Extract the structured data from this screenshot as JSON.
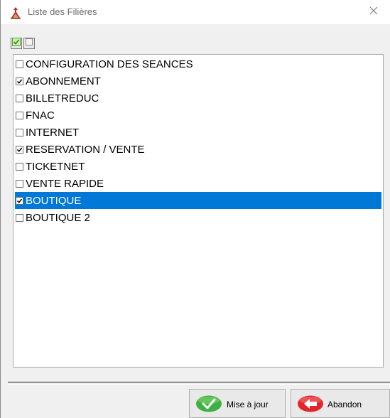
{
  "window": {
    "title": "Liste des Filières"
  },
  "toolbar": {
    "check_all_icon": "check-all-icon",
    "uncheck_all_icon": "uncheck-all-icon"
  },
  "list": {
    "items": [
      {
        "label": "CONFIGURATION DES SEANCES",
        "checked": false,
        "selected": false
      },
      {
        "label": "ABONNEMENT",
        "checked": true,
        "selected": false
      },
      {
        "label": "BILLETREDUC",
        "checked": false,
        "selected": false
      },
      {
        "label": "FNAC",
        "checked": false,
        "selected": false
      },
      {
        "label": "INTERNET",
        "checked": false,
        "selected": false
      },
      {
        "label": "RESERVATION / VENTE",
        "checked": true,
        "selected": false
      },
      {
        "label": "TICKETNET",
        "checked": false,
        "selected": false
      },
      {
        "label": "VENTE RAPIDE",
        "checked": false,
        "selected": false
      },
      {
        "label": "BOUTIQUE",
        "checked": true,
        "selected": true
      },
      {
        "label": "BOUTIQUE 2",
        "checked": false,
        "selected": false
      }
    ]
  },
  "buttons": {
    "update_label": "Mise à jour",
    "cancel_label": "Abandon"
  },
  "colors": {
    "selection": "#0078d7",
    "update_icon": "#3cb043",
    "cancel_icon": "#e3262b"
  }
}
